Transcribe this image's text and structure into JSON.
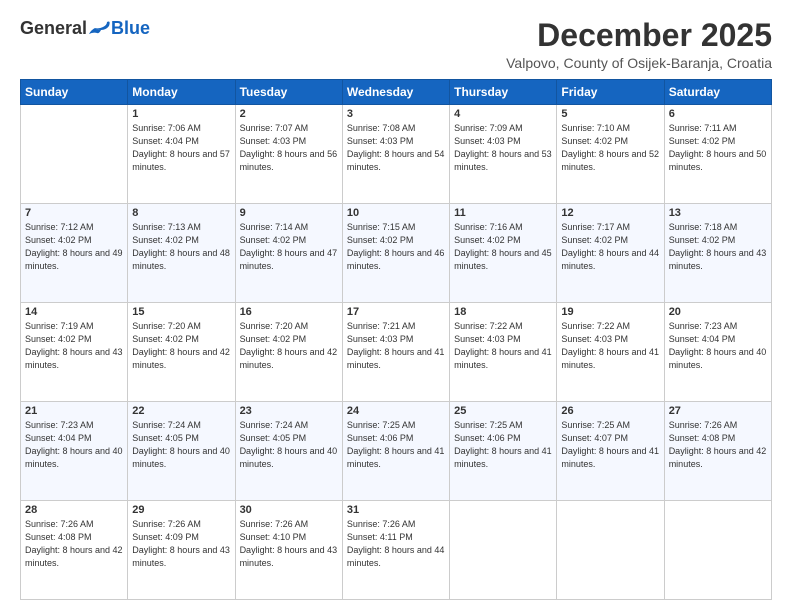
{
  "logo": {
    "general": "General",
    "blue": "Blue"
  },
  "header": {
    "month": "December 2025",
    "location": "Valpovo, County of Osijek-Baranja, Croatia"
  },
  "weekdays": [
    "Sunday",
    "Monday",
    "Tuesday",
    "Wednesday",
    "Thursday",
    "Friday",
    "Saturday"
  ],
  "weeks": [
    [
      {
        "day": "",
        "sunrise": "",
        "sunset": "",
        "daylight": ""
      },
      {
        "day": "1",
        "sunrise": "Sunrise: 7:06 AM",
        "sunset": "Sunset: 4:04 PM",
        "daylight": "Daylight: 8 hours and 57 minutes."
      },
      {
        "day": "2",
        "sunrise": "Sunrise: 7:07 AM",
        "sunset": "Sunset: 4:03 PM",
        "daylight": "Daylight: 8 hours and 56 minutes."
      },
      {
        "day": "3",
        "sunrise": "Sunrise: 7:08 AM",
        "sunset": "Sunset: 4:03 PM",
        "daylight": "Daylight: 8 hours and 54 minutes."
      },
      {
        "day": "4",
        "sunrise": "Sunrise: 7:09 AM",
        "sunset": "Sunset: 4:03 PM",
        "daylight": "Daylight: 8 hours and 53 minutes."
      },
      {
        "day": "5",
        "sunrise": "Sunrise: 7:10 AM",
        "sunset": "Sunset: 4:02 PM",
        "daylight": "Daylight: 8 hours and 52 minutes."
      },
      {
        "day": "6",
        "sunrise": "Sunrise: 7:11 AM",
        "sunset": "Sunset: 4:02 PM",
        "daylight": "Daylight: 8 hours and 50 minutes."
      }
    ],
    [
      {
        "day": "7",
        "sunrise": "Sunrise: 7:12 AM",
        "sunset": "Sunset: 4:02 PM",
        "daylight": "Daylight: 8 hours and 49 minutes."
      },
      {
        "day": "8",
        "sunrise": "Sunrise: 7:13 AM",
        "sunset": "Sunset: 4:02 PM",
        "daylight": "Daylight: 8 hours and 48 minutes."
      },
      {
        "day": "9",
        "sunrise": "Sunrise: 7:14 AM",
        "sunset": "Sunset: 4:02 PM",
        "daylight": "Daylight: 8 hours and 47 minutes."
      },
      {
        "day": "10",
        "sunrise": "Sunrise: 7:15 AM",
        "sunset": "Sunset: 4:02 PM",
        "daylight": "Daylight: 8 hours and 46 minutes."
      },
      {
        "day": "11",
        "sunrise": "Sunrise: 7:16 AM",
        "sunset": "Sunset: 4:02 PM",
        "daylight": "Daylight: 8 hours and 45 minutes."
      },
      {
        "day": "12",
        "sunrise": "Sunrise: 7:17 AM",
        "sunset": "Sunset: 4:02 PM",
        "daylight": "Daylight: 8 hours and 44 minutes."
      },
      {
        "day": "13",
        "sunrise": "Sunrise: 7:18 AM",
        "sunset": "Sunset: 4:02 PM",
        "daylight": "Daylight: 8 hours and 43 minutes."
      }
    ],
    [
      {
        "day": "14",
        "sunrise": "Sunrise: 7:19 AM",
        "sunset": "Sunset: 4:02 PM",
        "daylight": "Daylight: 8 hours and 43 minutes."
      },
      {
        "day": "15",
        "sunrise": "Sunrise: 7:20 AM",
        "sunset": "Sunset: 4:02 PM",
        "daylight": "Daylight: 8 hours and 42 minutes."
      },
      {
        "day": "16",
        "sunrise": "Sunrise: 7:20 AM",
        "sunset": "Sunset: 4:02 PM",
        "daylight": "Daylight: 8 hours and 42 minutes."
      },
      {
        "day": "17",
        "sunrise": "Sunrise: 7:21 AM",
        "sunset": "Sunset: 4:03 PM",
        "daylight": "Daylight: 8 hours and 41 minutes."
      },
      {
        "day": "18",
        "sunrise": "Sunrise: 7:22 AM",
        "sunset": "Sunset: 4:03 PM",
        "daylight": "Daylight: 8 hours and 41 minutes."
      },
      {
        "day": "19",
        "sunrise": "Sunrise: 7:22 AM",
        "sunset": "Sunset: 4:03 PM",
        "daylight": "Daylight: 8 hours and 41 minutes."
      },
      {
        "day": "20",
        "sunrise": "Sunrise: 7:23 AM",
        "sunset": "Sunset: 4:04 PM",
        "daylight": "Daylight: 8 hours and 40 minutes."
      }
    ],
    [
      {
        "day": "21",
        "sunrise": "Sunrise: 7:23 AM",
        "sunset": "Sunset: 4:04 PM",
        "daylight": "Daylight: 8 hours and 40 minutes."
      },
      {
        "day": "22",
        "sunrise": "Sunrise: 7:24 AM",
        "sunset": "Sunset: 4:05 PM",
        "daylight": "Daylight: 8 hours and 40 minutes."
      },
      {
        "day": "23",
        "sunrise": "Sunrise: 7:24 AM",
        "sunset": "Sunset: 4:05 PM",
        "daylight": "Daylight: 8 hours and 40 minutes."
      },
      {
        "day": "24",
        "sunrise": "Sunrise: 7:25 AM",
        "sunset": "Sunset: 4:06 PM",
        "daylight": "Daylight: 8 hours and 41 minutes."
      },
      {
        "day": "25",
        "sunrise": "Sunrise: 7:25 AM",
        "sunset": "Sunset: 4:06 PM",
        "daylight": "Daylight: 8 hours and 41 minutes."
      },
      {
        "day": "26",
        "sunrise": "Sunrise: 7:25 AM",
        "sunset": "Sunset: 4:07 PM",
        "daylight": "Daylight: 8 hours and 41 minutes."
      },
      {
        "day": "27",
        "sunrise": "Sunrise: 7:26 AM",
        "sunset": "Sunset: 4:08 PM",
        "daylight": "Daylight: 8 hours and 42 minutes."
      }
    ],
    [
      {
        "day": "28",
        "sunrise": "Sunrise: 7:26 AM",
        "sunset": "Sunset: 4:08 PM",
        "daylight": "Daylight: 8 hours and 42 minutes."
      },
      {
        "day": "29",
        "sunrise": "Sunrise: 7:26 AM",
        "sunset": "Sunset: 4:09 PM",
        "daylight": "Daylight: 8 hours and 43 minutes."
      },
      {
        "day": "30",
        "sunrise": "Sunrise: 7:26 AM",
        "sunset": "Sunset: 4:10 PM",
        "daylight": "Daylight: 8 hours and 43 minutes."
      },
      {
        "day": "31",
        "sunrise": "Sunrise: 7:26 AM",
        "sunset": "Sunset: 4:11 PM",
        "daylight": "Daylight: 8 hours and 44 minutes."
      },
      {
        "day": "",
        "sunrise": "",
        "sunset": "",
        "daylight": ""
      },
      {
        "day": "",
        "sunrise": "",
        "sunset": "",
        "daylight": ""
      },
      {
        "day": "",
        "sunrise": "",
        "sunset": "",
        "daylight": ""
      }
    ]
  ]
}
